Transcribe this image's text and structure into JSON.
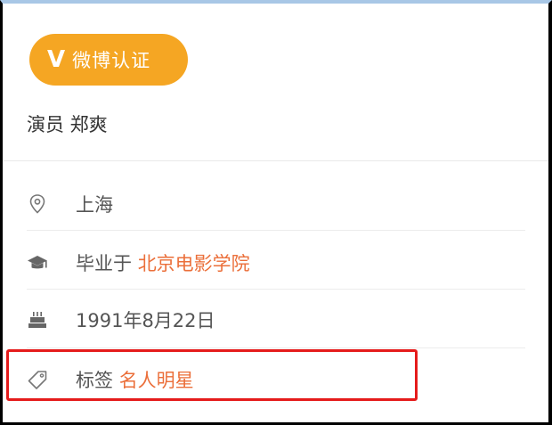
{
  "badge": {
    "icon": "V",
    "label": "微博认证"
  },
  "description": "演员 郑爽",
  "info_rows": [
    {
      "icon": "location-pin-icon",
      "prefix": "上海",
      "link": ""
    },
    {
      "icon": "graduation-cap-icon",
      "prefix": "毕业于 ",
      "link": "北京电影学院"
    },
    {
      "icon": "birthday-cake-icon",
      "prefix": "1991年8月22日",
      "link": ""
    },
    {
      "icon": "tag-icon",
      "prefix": "标签 ",
      "link": "名人明星"
    }
  ],
  "colors": {
    "badge": "#f5a623",
    "link": "#eb6f3a",
    "highlight_border": "#e51b1b",
    "text": "#555555"
  }
}
